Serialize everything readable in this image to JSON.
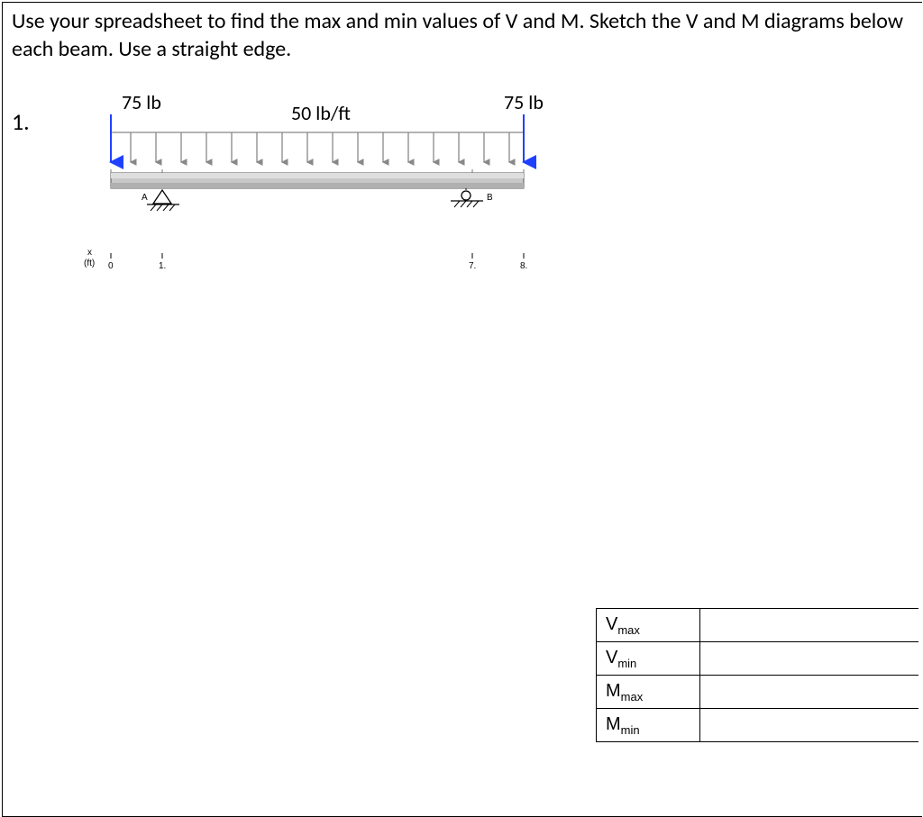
{
  "instructions": "Use your spreadsheet to find the max and min values of V and M.  Sketch the V and M diagrams below each beam.  Use a straight edge.",
  "problem_num": "1.",
  "beam": {
    "left_load_label": "75 lb",
    "right_load_label": "75 lb",
    "distributed_load_label": "50 lb/ft",
    "support_a_label": "A",
    "support_b_label": "B",
    "x_axis_label": "x",
    "x_axis_unit": "(ft)",
    "ticks": {
      "t0": "0",
      "t1": "1.",
      "t7": "7.",
      "t8": "8."
    }
  },
  "results": {
    "Vmax_sym": "V",
    "Vmax_sub": "max",
    "Vmax_val": "",
    "Vmin_sym": "V",
    "Vmin_sub": "min",
    "Vmin_val": "",
    "Mmax_sym": "M",
    "Mmax_sub": "max",
    "Mmax_val": "",
    "Mmin_sym": "M",
    "Mmin_sub": "min",
    "Mmin_val": ""
  }
}
